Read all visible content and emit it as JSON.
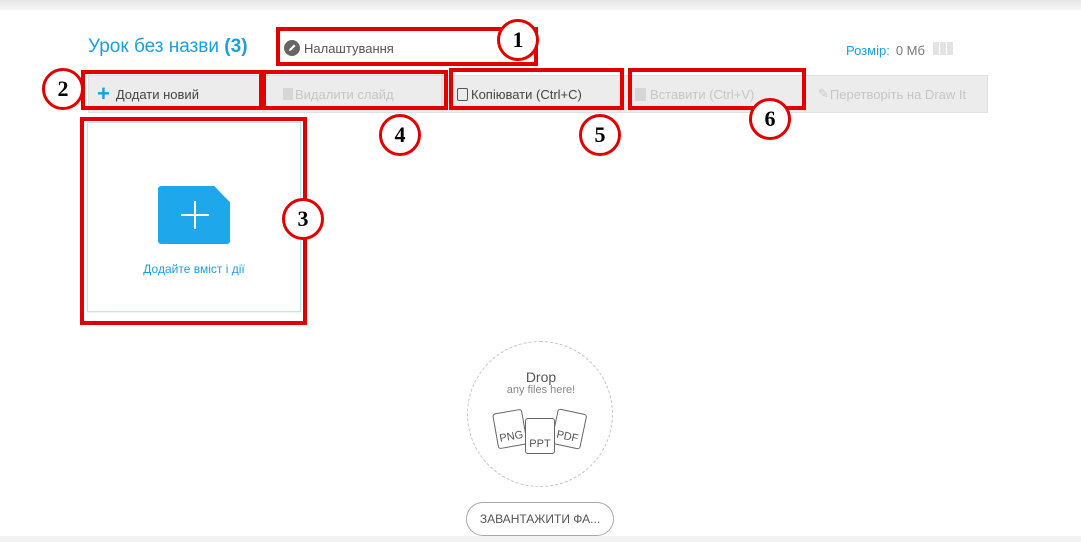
{
  "header": {
    "lesson_title": "Урок без назви",
    "lesson_count": "(3)",
    "settings_label": "Налаштування",
    "size_label": "Розмір:",
    "size_value": "0 Мб"
  },
  "toolbar": {
    "add_new": "Додати новий",
    "delete_slide": "Видалити слайд",
    "copy": "Копіювати (Ctrl+C)",
    "paste": "Вставити (Ctrl+V)",
    "convert": "Перетворіть на Draw It"
  },
  "slide": {
    "add_content_label": "Додайте вміст і дії"
  },
  "dropzone": {
    "title": "Drop",
    "subtitle": "any files here!",
    "file_types": [
      "PNG",
      "PPT",
      "PDF"
    ],
    "upload_button": "ЗАВАНТАЖИТИ ФА..."
  },
  "annotations": [
    "1",
    "2",
    "3",
    "4",
    "5",
    "6"
  ],
  "colors": {
    "accent": "#1a9fe0",
    "highlight": "#e00000",
    "toolbar_bg": "#ececec"
  }
}
